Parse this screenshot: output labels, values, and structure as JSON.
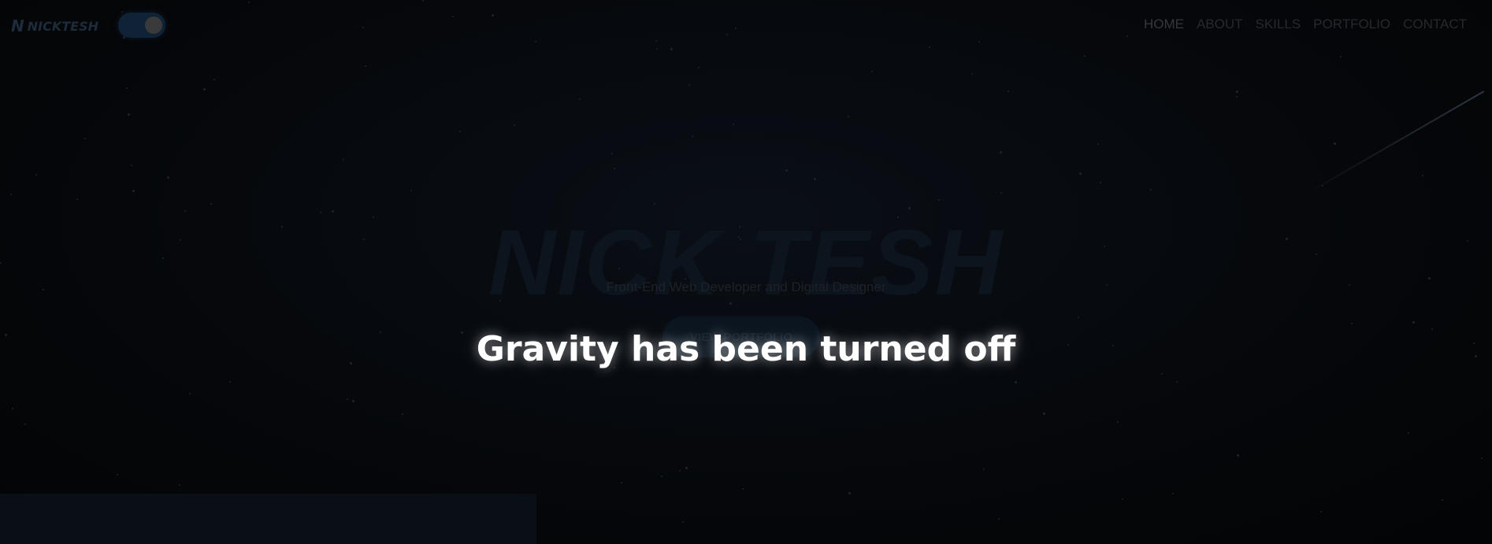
{
  "header": {
    "logo_mark": "N",
    "logo_text": "NICKTESH",
    "nav": [
      {
        "label": "HOME"
      },
      {
        "label": "ABOUT"
      },
      {
        "label": "SKILLS"
      },
      {
        "label": "PORTFOLIO"
      },
      {
        "label": "CONTACT"
      }
    ]
  },
  "hero": {
    "title": "NICK TESH",
    "subtitle": "Front-End Web Developer and Digital Designer",
    "cta_label": "VIEW PORTFOLIO"
  },
  "overlay": {
    "message": "Gravity has been turned off"
  },
  "theme_toggle": {
    "state": "on"
  },
  "colors": {
    "background": "#05070a",
    "overlay_text": "#ffffff"
  }
}
